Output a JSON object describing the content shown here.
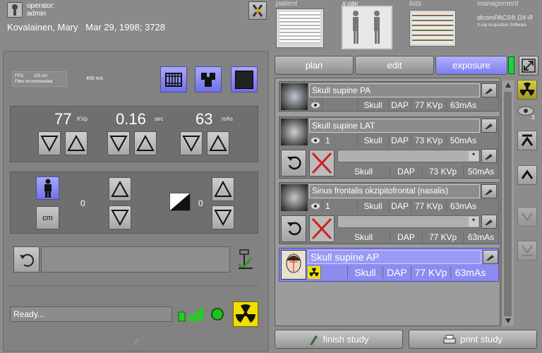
{
  "header": {
    "operator_label": "operator:",
    "operator_name": "admin",
    "patient_line": "Kovalainen, Mary   Mar 29, 1998; 3728",
    "nav": [
      "patient",
      "x-ray",
      "lists",
      "management"
    ],
    "brand_title": "dicomPACS® DX-R",
    "brand_sub": "X-ray Acquisition Software"
  },
  "technique": {
    "ffd": "FFD:        115 cm",
    "filter": "Filter recommended",
    "ma": "400 mA",
    "kvp": "77",
    "kvp_unit": "KVp",
    "sec": "0.16",
    "sec_unit": "sec",
    "mas": "63",
    "mas_unit": "mAs"
  },
  "positioning": {
    "height_value": "0",
    "height_unit_button": "cm",
    "wedge_value": "0"
  },
  "status": {
    "text": "Ready..."
  },
  "tabs": [
    "plan",
    "edit",
    "exposure"
  ],
  "exposures": [
    {
      "title": "Skull supine PA",
      "region": "Skull",
      "dap": "DAP",
      "kvp": "77 KVp",
      "mas": "63mAs",
      "done": false
    },
    {
      "title": "Skull supine LAT",
      "count": "1",
      "region": "Skull",
      "dap": "DAP",
      "kvp": "73 KVp",
      "mas": "50mAs",
      "done": true,
      "sub_region": "Skull",
      "sub_dap": "DAP",
      "sub_kvp": "73 KVp",
      "sub_mas": "50mAs"
    },
    {
      "title": "Sinus frontalis okzipitofrontal (nasalis)",
      "count": "1",
      "region": "Skull",
      "dap": "DAP",
      "kvp": "77 KVp",
      "mas": "63mAs",
      "done": true,
      "sub_region": "Skull",
      "sub_dap": "DAP",
      "sub_kvp": "77 KVp",
      "sub_mas": "63mAs"
    },
    {
      "title": "Skull supine AP",
      "region": "Skull",
      "dap": "DAP",
      "kvp": "77 KVp",
      "mas": "63mAs",
      "selected": true
    }
  ],
  "side": {
    "eye_count": "3"
  },
  "bottom": {
    "finish": "finish study",
    "print": "print study"
  },
  "colors": {
    "selected": "#8c8cf0",
    "radiation_yellow": "#f0e000",
    "ready_green": "#30d030"
  }
}
